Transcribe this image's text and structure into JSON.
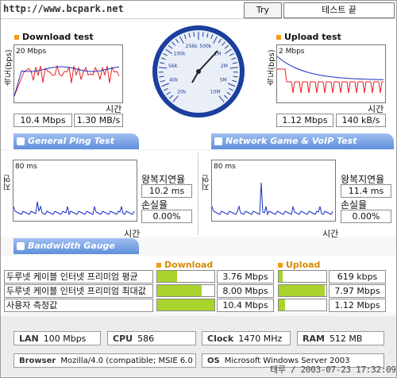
{
  "header": {
    "url": "http://www.bcpark.net",
    "try_again": "Try again",
    "test_done": "테스트 끝"
  },
  "download": {
    "title": "Download test",
    "ylabel": "속도(bps)",
    "max_label": "20 Mbps",
    "xlabel": "시간",
    "speed_mbps": "10.4 Mbps",
    "speed_mbs": "1.30 MB/s"
  },
  "upload": {
    "title": "Upload test",
    "ylabel": "속도(bps)",
    "max_label": "2 Mbps",
    "xlabel": "시간",
    "speed_mbps": "1.12 Mbps",
    "speed_kbs": "140 kB/s"
  },
  "gauge": {
    "ticks": [
      "20k",
      "40k",
      "56K",
      "100k",
      "256k",
      "500k",
      "1M",
      "2M",
      "5M",
      "10M"
    ]
  },
  "tabs": {
    "general_ping": "General Ping Test",
    "game_voip": "Network Game & VoIP Test",
    "bandwidth": "Bandwidth Gauge"
  },
  "ping_left": {
    "ylabel": "지연(ms)",
    "max_label": "80 ms",
    "xlabel": "시간",
    "rtt_label": "왕복지연율",
    "rtt_value": "10.2 ms",
    "loss_label": "손실율",
    "loss_value": "0.00%"
  },
  "ping_right": {
    "ylabel": "지연(ms)",
    "max_label": "80 ms",
    "xlabel": "시간",
    "rtt_label": "왕복지연율",
    "rtt_value": "11.4 ms",
    "loss_label": "손실율",
    "loss_value": "0.00%"
  },
  "bandwidth": {
    "download_header": "Download",
    "upload_header": "Upload",
    "rows": [
      {
        "label": "두루넷 케이블 인터넷 프리미엄 평균",
        "down": "3.76 Mbps",
        "down_fill": 0.35,
        "up": "619 kbps",
        "up_fill": 0.08
      },
      {
        "label": "두루넷 케이블 인터넷 프리미엄 최대값",
        "down": "8.00 Mbps",
        "down_fill": 0.78,
        "up": "7.97 Mbps",
        "up_fill": 0.97
      },
      {
        "label": "사용자 측정값",
        "down": "10.4 Mbps",
        "down_fill": 1.0,
        "up": "1.12 Mbps",
        "up_fill": 0.14
      }
    ]
  },
  "sysinfo": {
    "lan_label": "LAN",
    "lan_value": "100 Mbps",
    "cpu_label": "CPU",
    "cpu_value": "586",
    "clock_label": "Clock",
    "clock_value": "1470 MHz",
    "ram_label": "RAM",
    "ram_value": "512 MB",
    "browser_label": "Browser",
    "browser_value": "Mozilla/4.0 (compatible; MSIE 6.0",
    "os_label": "OS",
    "os_value": "Microsoft Windows Server 2003"
  },
  "footer": {
    "stamp": "태루 / 2003-07-23 17:32:09"
  },
  "colors": {
    "download_measured": "#e82020",
    "download_average": "#1a2fbf",
    "ping_line": "#1a2fbf",
    "gauge_blue": "#1b3f9c",
    "tab_blue": "#5f8fdb",
    "bar_green": "#a8d42d",
    "accent_orange": "#f39c12"
  }
}
